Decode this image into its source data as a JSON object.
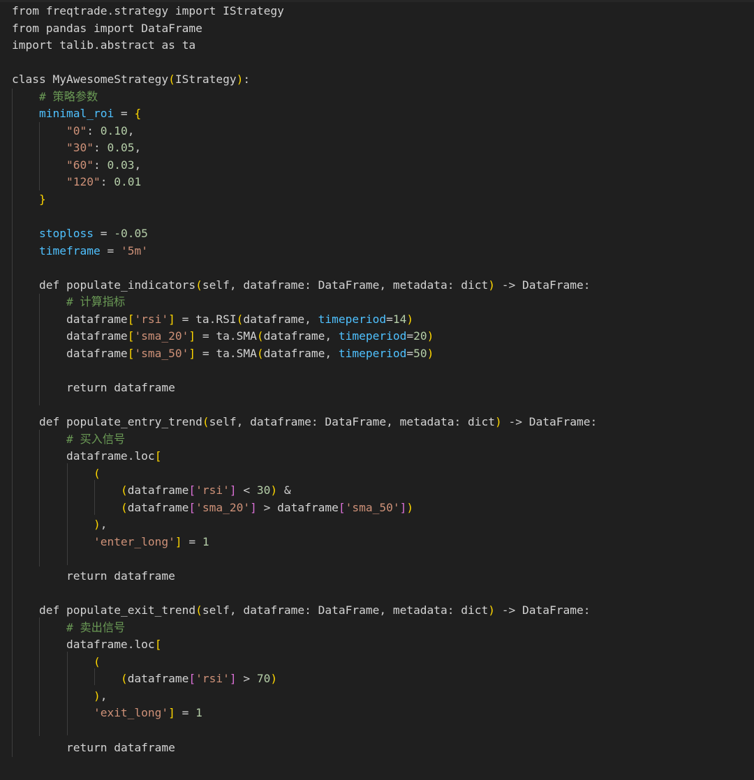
{
  "editor": {
    "language": "python",
    "colors": {
      "background": "#1f1f1f",
      "text": "#d4d4d4",
      "comment": "#6a9955",
      "string": "#ce9178",
      "variable": "#4fc1ff",
      "parameter": "#9cdcfe",
      "bracket_level_1": "#ffd700",
      "bracket_level_2": "#da70d6",
      "bracket_level_3": "#179fff"
    },
    "lines": [
      "from freqtrade.strategy import IStrategy",
      "from pandas import DataFrame",
      "import talib.abstract as ta",
      "",
      "class MyAwesomeStrategy(IStrategy):",
      "    # 策略参数",
      "    minimal_roi = {",
      "        \"0\": 0.10,",
      "        \"30\": 0.05,",
      "        \"60\": 0.03,",
      "        \"120\": 0.01",
      "    }",
      "",
      "    stoploss = -0.05",
      "    timeframe = '5m'",
      "",
      "    def populate_indicators(self, dataframe: DataFrame, metadata: dict) -> DataFrame:",
      "        # 计算指标",
      "        dataframe['rsi'] = ta.RSI(dataframe, timeperiod=14)",
      "        dataframe['sma_20'] = ta.SMA(dataframe, timeperiod=20)",
      "        dataframe['sma_50'] = ta.SMA(dataframe, timeperiod=50)",
      "",
      "        return dataframe",
      "",
      "    def populate_entry_trend(self, dataframe: DataFrame, metadata: dict) -> DataFrame:",
      "        # 买入信号",
      "        dataframe.loc[",
      "            (",
      "                (dataframe['rsi'] < 30) &",
      "                (dataframe['sma_20'] > dataframe['sma_50'])",
      "            ),",
      "            'enter_long'] = 1",
      "",
      "        return dataframe",
      "",
      "    def populate_exit_trend(self, dataframe: DataFrame, metadata: dict) -> DataFrame:",
      "        # 卖出信号",
      "        dataframe.loc[",
      "            (",
      "                (dataframe['rsi'] > 70)",
      "            ),",
      "            'exit_long'] = 1",
      "",
      "        return dataframe"
    ]
  }
}
